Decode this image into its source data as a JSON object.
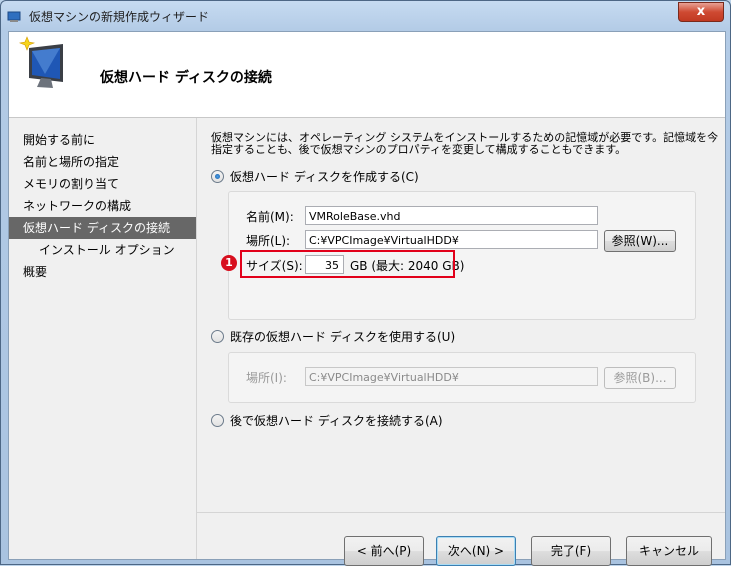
{
  "window": {
    "title": "仮想マシンの新規作成ウィザード",
    "close": "x"
  },
  "header": {
    "title": "仮想ハード ディスクの接続"
  },
  "nav": {
    "items": [
      {
        "label": "開始する前に"
      },
      {
        "label": "名前と場所の指定"
      },
      {
        "label": "メモリの割り当て"
      },
      {
        "label": "ネットワークの構成"
      },
      {
        "label": "仮想ハード ディスクの接続"
      },
      {
        "label": "インストール オプション"
      },
      {
        "label": "概要"
      }
    ]
  },
  "content": {
    "description": "仮想マシンには、オペレーティング システムをインストールするための記憶域が必要です。記憶域を今指定することも、後で仮想マシンのプロパティを変更して構成することもできます。",
    "option_create": {
      "label": "仮想ハード ディスクを作成する(C)",
      "name_label": "名前(M):",
      "name_value": "VMRoleBase.vhd",
      "location_label": "場所(L):",
      "location_value": "C:¥VPCImage¥VirtualHDD¥",
      "browse_label": "参照(W)...",
      "size_label": "サイズ(S):",
      "size_value": "35",
      "size_unit": "GB (最大: 2040 GB)",
      "marker": "1"
    },
    "option_existing": {
      "label": "既存の仮想ハード ディスクを使用する(U)",
      "location_label": "場所(I):",
      "location_value": "C:¥VPCImage¥VirtualHDD¥",
      "browse_label": "参照(B)..."
    },
    "option_later": {
      "label": "後で仮想ハード ディスクを接続する(A)"
    }
  },
  "footer": {
    "back": "< 前へ(P)",
    "next": "次へ(N) >",
    "finish": "完了(F)",
    "cancel": "キャンセル"
  },
  "colors": {
    "active_nav": "#676767",
    "highlight": "#e2001a",
    "marker": "#d70f1e"
  }
}
